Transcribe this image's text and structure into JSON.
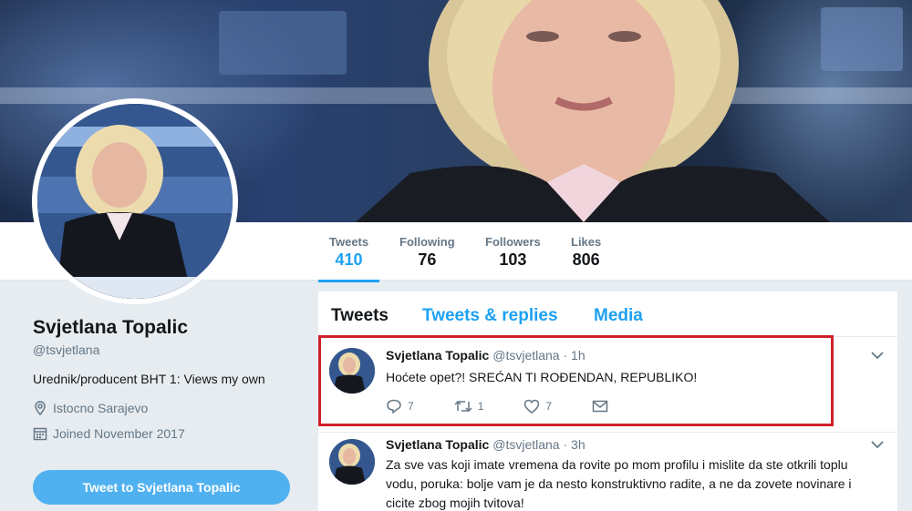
{
  "profile": {
    "name": "Svjetlana Topalic",
    "handle": "@tsvjetlana",
    "bio": "Urednik/producent BHT 1: Views my own",
    "location": "Istocno Sarajevo",
    "joined": "Joined November 2017",
    "tweet_to_label": "Tweet to Svjetlana Topalic"
  },
  "stats": [
    {
      "label": "Tweets",
      "value": "410"
    },
    {
      "label": "Following",
      "value": "76"
    },
    {
      "label": "Followers",
      "value": "103"
    },
    {
      "label": "Likes",
      "value": "806"
    }
  ],
  "tabs": [
    "Tweets",
    "Tweets & replies",
    "Media"
  ],
  "tweets": [
    {
      "name": "Svjetlana Topalic",
      "meta": "@tsvjetlana · 1h",
      "text": "Hoćete opet?! SREĆAN TI ROĐENDAN, REPUBLIKO!",
      "replies": "7",
      "retweets": "1",
      "likes": "7"
    },
    {
      "name": "Svjetlana Topalic",
      "meta": "@tsvjetlana · 3h",
      "text": "Za sve vas koji imate vremena da rovite po mom profilu i mislite da ste otkrili toplu vodu, poruka: bolje vam je da nesto konstruktivno radite, a ne da zovete novinare i cicite zbog mojih tvitova!"
    }
  ],
  "colors": {
    "accent": "#1da1f2",
    "highlight_border": "#d0202a",
    "button": "#50b1f0"
  }
}
